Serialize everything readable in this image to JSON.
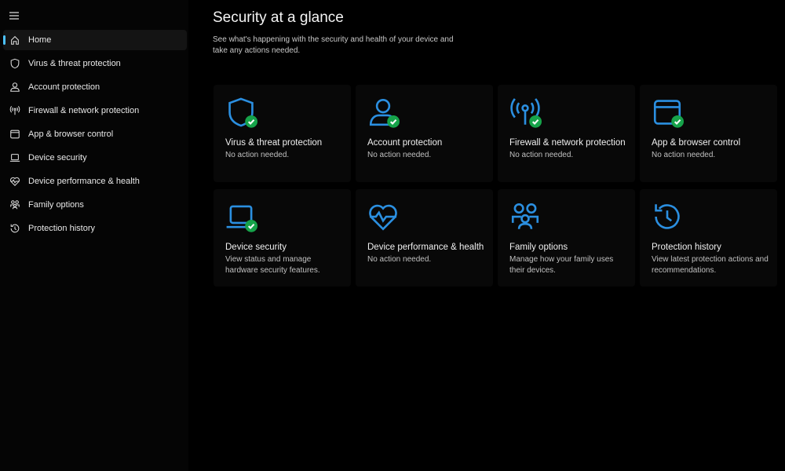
{
  "sidebar": {
    "items": [
      {
        "label": "Home",
        "icon": "home-icon",
        "selected": true
      },
      {
        "label": "Virus & threat protection",
        "icon": "shield-icon"
      },
      {
        "label": "Account protection",
        "icon": "person-icon"
      },
      {
        "label": "Firewall & network protection",
        "icon": "antenna-icon"
      },
      {
        "label": "App & browser control",
        "icon": "window-icon"
      },
      {
        "label": "Device security",
        "icon": "laptop-icon"
      },
      {
        "label": "Device performance & health",
        "icon": "heart-icon"
      },
      {
        "label": "Family options",
        "icon": "family-icon"
      },
      {
        "label": "Protection history",
        "icon": "history-icon"
      }
    ]
  },
  "main": {
    "title": "Security at a glance",
    "subtitle": "See what's happening with the security and health of your device and take any actions needed.",
    "cards": [
      {
        "title": "Virus & threat protection",
        "status": "No action needed.",
        "icon": "shield-icon",
        "ok": true
      },
      {
        "title": "Account protection",
        "status": "No action needed.",
        "icon": "person-icon",
        "ok": true
      },
      {
        "title": "Firewall & network protection",
        "status": "No action needed.",
        "icon": "antenna-icon",
        "ok": true
      },
      {
        "title": "App & browser control",
        "status": "No action needed.",
        "icon": "window-icon",
        "ok": true
      },
      {
        "title": "Device security",
        "status": "View status and manage hardware security features.",
        "icon": "laptop-icon",
        "ok": true
      },
      {
        "title": "Device performance & health",
        "status": "No action needed.",
        "icon": "heart-icon",
        "ok": false
      },
      {
        "title": "Family options",
        "status": "Manage how your family uses their devices.",
        "icon": "family-icon",
        "ok": false
      },
      {
        "title": "Protection history",
        "status": "View latest protection actions and recommendations.",
        "icon": "history-icon",
        "ok": false
      }
    ]
  },
  "colors": {
    "accent": "#2b8fe0",
    "ok": "#16a34a",
    "nav_indicator": "#4cc2ff"
  }
}
